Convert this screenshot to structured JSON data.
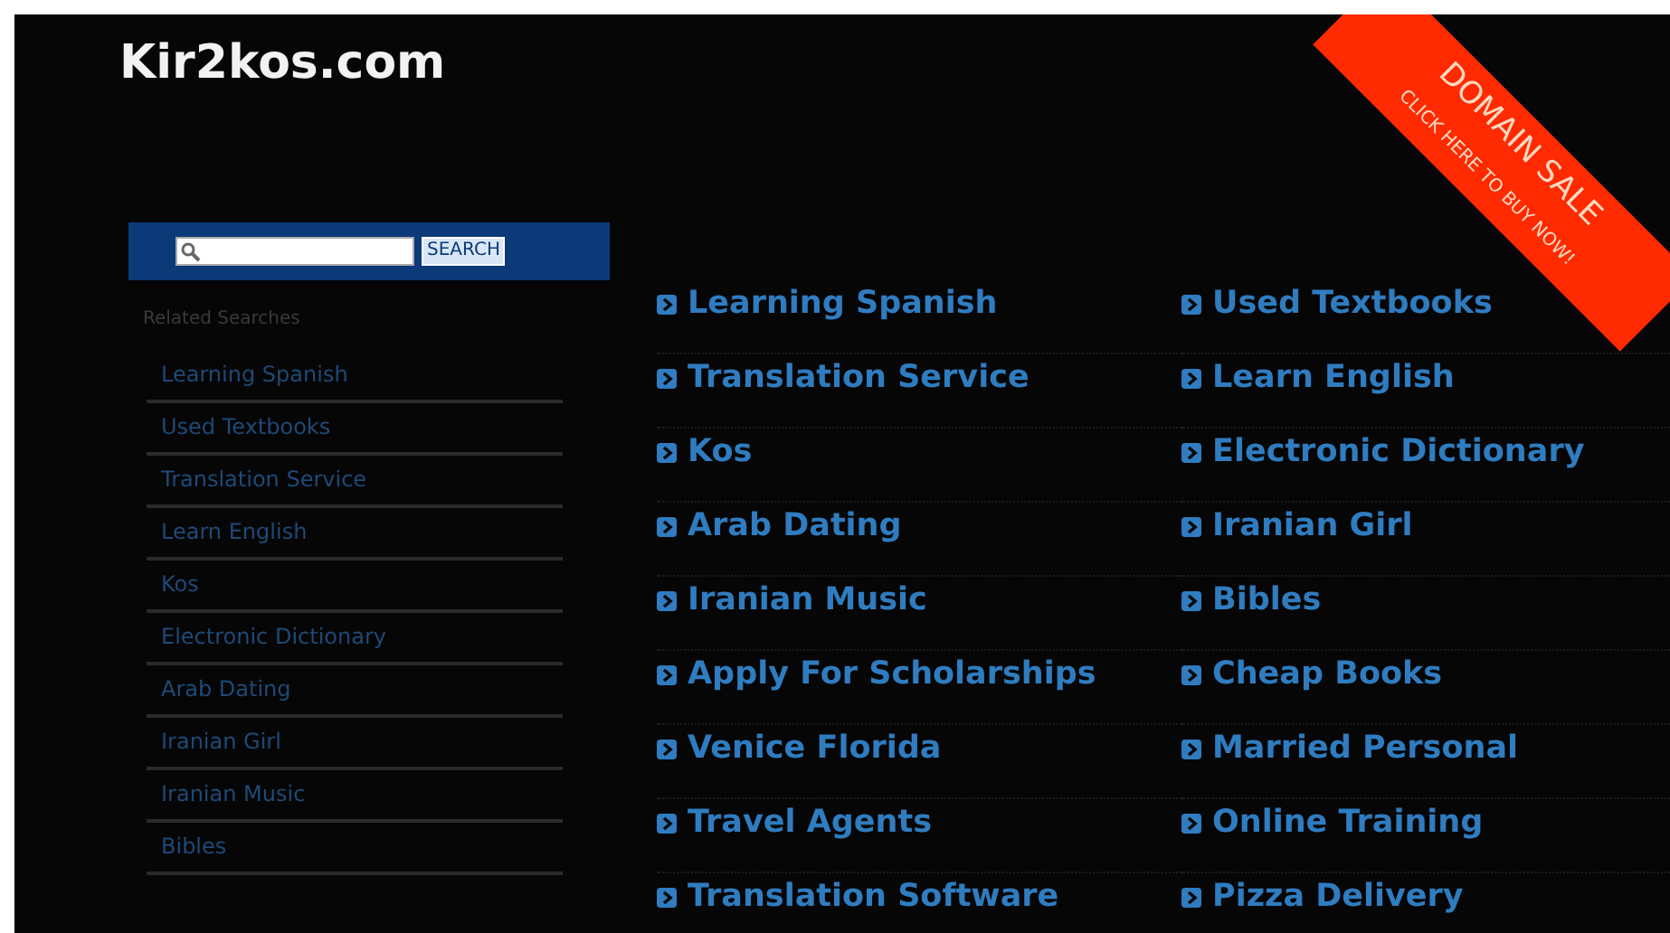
{
  "logo": "Kir2kos.com",
  "search": {
    "button": "SEARCH"
  },
  "related": {
    "heading": "Related Searches",
    "items": [
      "Learning Spanish",
      "Used Textbooks",
      "Translation Service",
      "Learn English",
      "Kos",
      "Electronic Dictionary",
      "Arab Dating",
      "Iranian Girl",
      "Iranian Music",
      "Bibles"
    ]
  },
  "links": [
    "Learning Spanish",
    "Used Textbooks",
    "Translation Service",
    "Learn English",
    "Kos",
    "Electronic Dictionary",
    "Arab Dating",
    "Iranian Girl",
    "Iranian Music",
    "Bibles",
    "Apply For Scholarships",
    "Cheap Books",
    "Venice Florida",
    "Married Personal",
    "Travel Agents",
    "Online Training",
    "Translation Software",
    "Pizza Delivery"
  ],
  "banner": {
    "title": "DOMAIN SALE",
    "subtitle": "CLICK HERE TO BUY NOW!"
  }
}
